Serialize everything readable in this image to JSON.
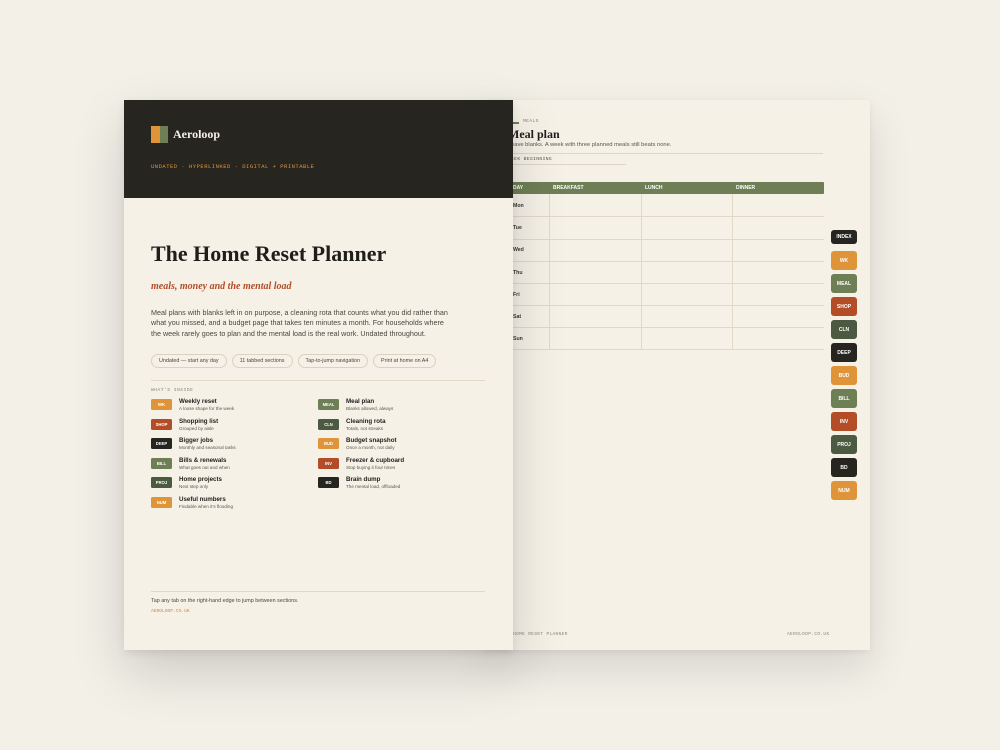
{
  "colors": {
    "ink": "#262520",
    "amber": "#e0943a",
    "sage": "#6e7f56",
    "rust": "#b34d28",
    "forest": "#4b5a40",
    "paper": "#f5f1e7"
  },
  "front": {
    "brand": "Aeroloop",
    "flags": "UNDATED  ·  HYPERLINKED  ·  DIGITAL + PRINTABLE",
    "title": "The Home Reset Planner",
    "subtitle": "meals, money and the mental load",
    "description": "Meal plans with blanks left in on purpose, a cleaning rota that counts what you did rather than what you missed, and a budget page that takes ten minutes a month. For households where the week rarely goes to plan and the mental load is the real work. Undated throughout.",
    "pills": [
      "Undated — start any day",
      "11 tabbed sections",
      "Tap-to-jump navigation",
      "Print at home on A4"
    ],
    "inside_label": "WHAT'S INSIDE",
    "toc": [
      {
        "tag": "WK",
        "title": "Weekly reset",
        "desc": "A loose shape for the week",
        "color": "#e0943a"
      },
      {
        "tag": "SHOP",
        "title": "Shopping list",
        "desc": "Grouped by aisle",
        "color": "#b34d28"
      },
      {
        "tag": "DEEP",
        "title": "Bigger jobs",
        "desc": "Monthly and seasonal tasks",
        "color": "#262520"
      },
      {
        "tag": "BILL",
        "title": "Bills & renewals",
        "desc": "What goes out and when",
        "color": "#6e7f56"
      },
      {
        "tag": "PROJ",
        "title": "Home projects",
        "desc": "Next step only",
        "color": "#4b5a40"
      },
      {
        "tag": "NUM",
        "title": "Useful numbers",
        "desc": "Findable when it's flooding",
        "color": "#e0943a"
      },
      {
        "tag": "MEAL",
        "title": "Meal plan",
        "desc": "Blanks allowed, always",
        "color": "#6e7f56"
      },
      {
        "tag": "CLN",
        "title": "Cleaning rota",
        "desc": "Totals, not streaks",
        "color": "#4b5a40"
      },
      {
        "tag": "BUD",
        "title": "Budget snapshot",
        "desc": "Once a month, not daily",
        "color": "#e0943a"
      },
      {
        "tag": "INV",
        "title": "Freezer & cupboard",
        "desc": "Stop buying it four times",
        "color": "#b34d28"
      },
      {
        "tag": "BD",
        "title": "Brain dump",
        "desc": "The mental load, offloaded",
        "color": "#262520"
      }
    ],
    "footer_text": "Tap any tab on the right-hand edge to jump between sections.",
    "footer_url": "AEROLOOP.CO.UK"
  },
  "back": {
    "section_label": "MEALS",
    "title": "Meal plan",
    "subtitle": "eave blanks. A week with three planned meals still beats none.",
    "week_label": "EEK BEGINNING",
    "columns": [
      "DAY",
      "BREAKFAST",
      "LUNCH",
      "DINNER"
    ],
    "days": [
      "Mon",
      "Tue",
      "Wed",
      "Thu",
      "Fri",
      "Sat",
      "Sun"
    ],
    "footer_left": "E HOME RESET PLANNER",
    "footer_right": "AEROLOOP.CO.UK"
  },
  "side_tabs": [
    {
      "label": "INDEX",
      "color": "#262520"
    },
    {
      "label": "WK",
      "color": "#e0943a"
    },
    {
      "label": "MEAL",
      "color": "#6e7f56"
    },
    {
      "label": "SHOP",
      "color": "#b34d28"
    },
    {
      "label": "CLN",
      "color": "#4b5a40"
    },
    {
      "label": "DEEP",
      "color": "#262520"
    },
    {
      "label": "BUD",
      "color": "#e0943a"
    },
    {
      "label": "BILL",
      "color": "#6e7f56"
    },
    {
      "label": "INV",
      "color": "#b34d28"
    },
    {
      "label": "PROJ",
      "color": "#4b5a40"
    },
    {
      "label": "BD",
      "color": "#262520"
    },
    {
      "label": "NUM",
      "color": "#e0943a"
    }
  ]
}
